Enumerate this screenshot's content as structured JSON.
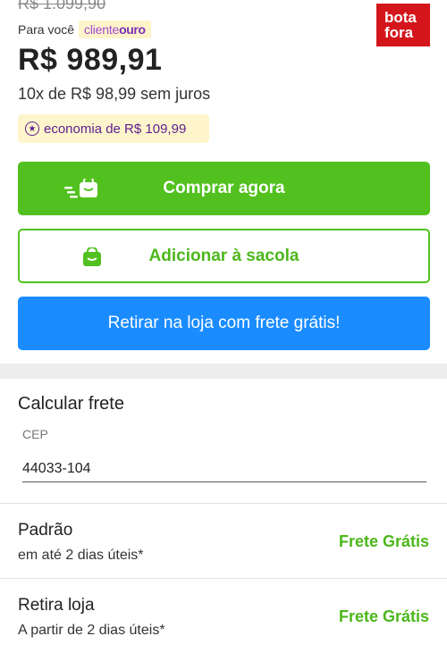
{
  "product": {
    "old_price": "R$ 1.099,90",
    "para_voce": "Para você",
    "cliente": "cliente",
    "ouro": "ouro",
    "price": "R$ 989,91",
    "installments": "10x de R$ 98,99 sem juros",
    "economy": "economia de R$ 109,99"
  },
  "brand_badge": {
    "line1": "bota",
    "line2": "fora",
    "color": "#d4161c"
  },
  "buttons": {
    "buy_now": "Comprar agora",
    "add_bag": "Adicionar à sacola",
    "store_pickup": "Retirar na loja com frete grátis!"
  },
  "shipping": {
    "title": "Calcular frete",
    "cep_label": "CEP",
    "cep_value": "44033-104",
    "options": [
      {
        "name": "Padrão",
        "days": "em até 2 dias úteis*",
        "price": "Frete Grátis"
      },
      {
        "name": "Retira loja",
        "days": "A partir de 2 dias úteis*",
        "price": "Frete Grátis"
      }
    ]
  },
  "colors": {
    "green": "#52c11f",
    "blue": "#1a8cff",
    "purple": "#5b1f8f"
  },
  "icons": {
    "buy": "fast-bag-icon",
    "bag": "bag-icon",
    "economy": "star-circle-icon"
  }
}
